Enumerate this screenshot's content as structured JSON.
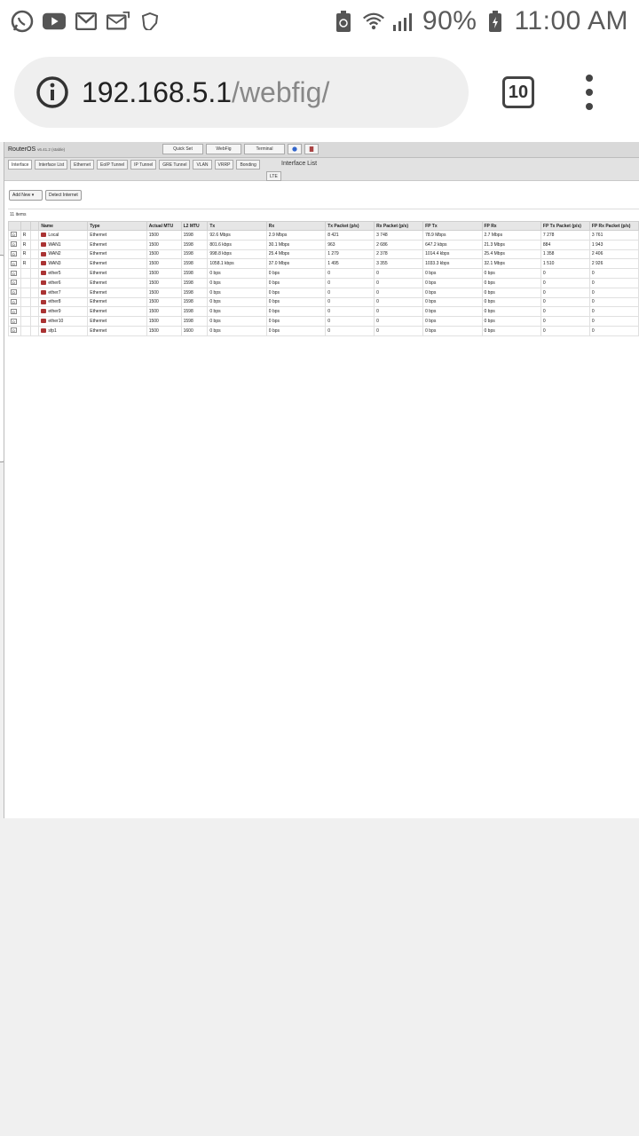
{
  "status_bar": {
    "battery": "90%",
    "time": "11:00 AM",
    "icons": [
      "whatsapp-icon",
      "youtube-icon",
      "gmail-icon",
      "mail-icon",
      "vpn-shield-icon",
      "battery-saver-icon",
      "wifi-icon",
      "signal-icon",
      "battery-icon"
    ]
  },
  "browser": {
    "url_host": "192.168.5.1",
    "url_path": "/webfig/",
    "tab_count": "10"
  },
  "webfig": {
    "brand": "RouterOS",
    "version": "v6.41.2 (stable)",
    "modes": [
      "Quick Set",
      "WebFig",
      "Terminal"
    ],
    "tabs": [
      "Interface",
      "Interface List",
      "Ethernet",
      "EoIP Tunnel",
      "IP Tunnel",
      "GRE Tunnel",
      "VLAN",
      "VRRP",
      "Bonding"
    ],
    "tab_lte": "LTE",
    "section_title": "Interface List",
    "add_new": "Add New",
    "detect_internet": "Detect Internet",
    "items_count": "11 items",
    "columns": [
      "",
      "",
      "",
      "Name",
      "Type",
      "Actual MTU",
      "L2 MTU",
      "Tx",
      "Rx",
      "Tx Packet (p/s)",
      "Rx Packet (p/s)",
      "FP Tx",
      "FP Rx",
      "FP Tx Packet (p/s)",
      "FP Rx Packet (p/s)"
    ],
    "rows": [
      [
        "D",
        "R",
        "",
        "Local",
        "Ethernet",
        "1500",
        "1598",
        "92.6 Mbps",
        "2.9 Mbps",
        "8 421",
        "3 748",
        "78.9 Mbps",
        "2.7 Mbps",
        "7 278",
        "3 761"
      ],
      [
        "D",
        "R",
        "",
        "WAN1",
        "Ethernet",
        "1500",
        "1598",
        "801.6 kbps",
        "30.1 Mbps",
        "963",
        "2 686",
        "647.2 kbps",
        "21.3 Mbps",
        "884",
        "1 943"
      ],
      [
        "D",
        "R",
        "",
        "WAN2",
        "Ethernet",
        "1500",
        "1598",
        "998.8 kbps",
        "25.4 Mbps",
        "1 279",
        "2 378",
        "1014.4 kbps",
        "25.4 Mbps",
        "1 358",
        "2 406"
      ],
      [
        "D",
        "R",
        "",
        "WAN3",
        "Ethernet",
        "1500",
        "1598",
        "1058.1 kbps",
        "37.0 Mbps",
        "1 495",
        "3 355",
        "1033.3 kbps",
        "32.1 Mbps",
        "1 510",
        "2 926"
      ],
      [
        "D",
        "",
        "",
        "ether5",
        "Ethernet",
        "1500",
        "1598",
        "0 bps",
        "0 bps",
        "0",
        "0",
        "0 bps",
        "0 bps",
        "0",
        "0"
      ],
      [
        "D",
        "",
        "",
        "ether6",
        "Ethernet",
        "1500",
        "1598",
        "0 bps",
        "0 bps",
        "0",
        "0",
        "0 bps",
        "0 bps",
        "0",
        "0"
      ],
      [
        "D",
        "",
        "",
        "ether7",
        "Ethernet",
        "1500",
        "1598",
        "0 bps",
        "0 bps",
        "0",
        "0",
        "0 bps",
        "0 bps",
        "0",
        "0"
      ],
      [
        "D",
        "",
        "",
        "ether8",
        "Ethernet",
        "1500",
        "1598",
        "0 bps",
        "0 bps",
        "0",
        "0",
        "0 bps",
        "0 bps",
        "0",
        "0"
      ],
      [
        "D",
        "",
        "",
        "ether9",
        "Ethernet",
        "1500",
        "1598",
        "0 bps",
        "0 bps",
        "0",
        "0",
        "0 bps",
        "0 bps",
        "0",
        "0"
      ],
      [
        "D",
        "",
        "",
        "ether10",
        "Ethernet",
        "1500",
        "1598",
        "0 bps",
        "0 bps",
        "0",
        "0",
        "0 bps",
        "0 bps",
        "0",
        "0"
      ],
      [
        "D",
        "",
        "",
        "sfp1",
        "Ethernet",
        "1500",
        "1600",
        "0 bps",
        "0 bps",
        "0",
        "0",
        "0 bps",
        "0 bps",
        "0",
        "0"
      ]
    ]
  }
}
